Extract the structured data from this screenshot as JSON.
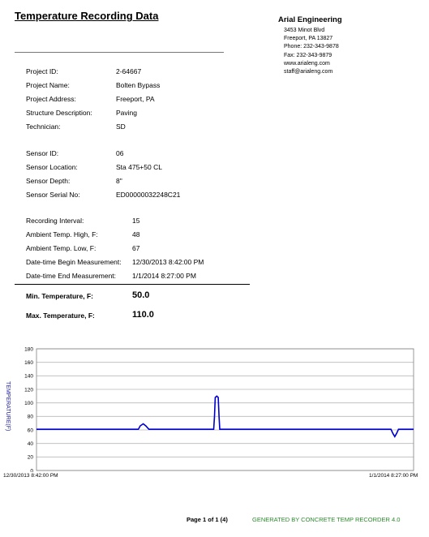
{
  "header": {
    "title": "Temperature Recording Data",
    "company": "Arial Engineering",
    "address_lines": [
      "3453 Minot Blvd",
      "Freeport, PA 13827",
      "Phone: 232-343-9878",
      "Fax: 232-343-9879",
      "www.arialeng.com",
      "staff@arialeng.com"
    ]
  },
  "project": [
    {
      "label": "Project ID:",
      "value": "2-64667"
    },
    {
      "label": "Project Name:",
      "value": "Bolten Bypass"
    },
    {
      "label": "Project Address:",
      "value": "Freeport, PA"
    },
    {
      "label": "Structure Description:",
      "value": "Paving"
    },
    {
      "label": "Technician:",
      "value": "SD"
    }
  ],
  "sensor": [
    {
      "label": "Sensor ID:",
      "value": "06"
    },
    {
      "label": "Sensor Location:",
      "value": "Sta 475+50 CL"
    },
    {
      "label": "Sensor Depth:",
      "value": "8\""
    },
    {
      "label": "Sensor Serial No:",
      "value": "ED00000032248C21"
    }
  ],
  "recording": [
    {
      "label": "Recording Interval:",
      "value": "15"
    },
    {
      "label": "Ambient Temp. High, F:",
      "value": "48"
    },
    {
      "label": "Ambient  Temp. Low, F:",
      "value": "67"
    },
    {
      "label": "Date-time Begin Measurement:",
      "value": "12/30/2013 8:42:00 PM"
    },
    {
      "label": "Date-time End Measurement:",
      "value": "1/1/2014 8:27:00 PM"
    }
  ],
  "summary": {
    "min_label": "Min. Temperature, F:",
    "min_value": "50.0",
    "max_label": "Max. Temperature, F:",
    "max_value": "110.0"
  },
  "chart_data": {
    "type": "line",
    "ylabel": "TEMPERATURE(F)",
    "ylim": [
      0,
      180
    ],
    "yticks": [
      "0",
      "20",
      "40",
      "60",
      "80",
      "100",
      "120",
      "140",
      "160",
      "180"
    ],
    "x_start_label": "12/30/2013 8:42:00 PM",
    "x_end_label": "1/1/2014 8:27:00 PM",
    "grid": true,
    "line_color": "#0000cc",
    "series": [
      {
        "x": [
          0,
          0.27,
          0.275,
          0.283,
          0.29,
          0.298,
          0.47,
          0.472,
          0.474,
          0.478,
          0.482,
          0.484,
          0.486,
          0.94,
          0.945,
          0.95,
          0.955,
          0.96,
          1.0
        ],
        "y": [
          61,
          61,
          66,
          69,
          66,
          61,
          61,
          80,
          108,
          110,
          108,
          80,
          61,
          61,
          55,
          50,
          55,
          61,
          61
        ]
      }
    ]
  },
  "footer": {
    "page": "Page 1 of 1 (4)",
    "generated": "GENERATED BY CONCRETE TEMP RECORDER 4.0"
  }
}
